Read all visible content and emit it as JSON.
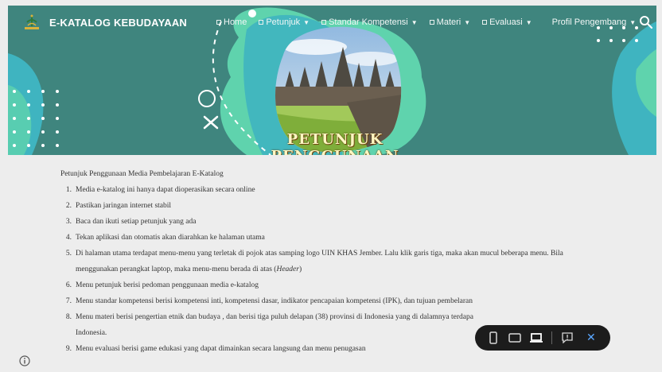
{
  "header": {
    "site_title": "E-KATALOG KEBUDAYAAN",
    "logo_icon": "logo-uin-khas-icon",
    "nav": [
      {
        "label": "Home",
        "dropdown": false
      },
      {
        "label": "Petunjuk",
        "dropdown": true
      },
      {
        "label": "Standar Kompetensi",
        "dropdown": true
      },
      {
        "label": "Materi",
        "dropdown": true
      },
      {
        "label": "Evaluasi",
        "dropdown": true
      },
      {
        "label": "Profil Pengembang",
        "dropdown": true
      }
    ],
    "search_icon": "search-icon"
  },
  "hero": {
    "banner_text": "PETUNJUK PENGGUNAAN",
    "colors": {
      "teal": "#3f857e",
      "mint": "#5fd3ad",
      "cyan": "#3fb4c0",
      "yellow_text": "#fff7c2"
    }
  },
  "content": {
    "title": "Petunjuk Penggunaan Media Pembelajaran E-Katalog",
    "steps": [
      {
        "num": "1.",
        "text": "Media e-katalog ini hanya dapat dioperasikan secara online"
      },
      {
        "num": "2.",
        "text": "Pastikan jaringan internet stabil"
      },
      {
        "num": "3.",
        "text": "Baca dan ikuti setiap petunjuk yang ada"
      },
      {
        "num": "4.",
        "text": "Tekan aplikasi dan otomatis akan diarahkan ke halaman utama"
      },
      {
        "num": "5.",
        "text": "Di halaman utama terdapat menu-menu yang terletak di pojok atas samping logo UIN KHAS Jember. Lalu klik garis tiga, maka akan mucul beberapa menu. Bila menggunakan perangkat laptop, maka menu-menu berada di atas (",
        "em": "Header",
        "tail": ")"
      },
      {
        "num": "6.",
        "text": "Menu petunjuk berisi pedoman penggunaan media e-katalog"
      },
      {
        "num": "7.",
        "text": "Menu standar kompetensi berisi kompetensi inti, kompetensi dasar, indikator pencapaian kompetensi (IPK), dan tujuan pembelaran"
      },
      {
        "num": "8.",
        "text": "Menu materi berisi pengertian etnik dan budaya , dan berisi tiga puluh delapan (38) provinsi di Indonesia yang di dalamnya terdapa",
        "tail2": "Indonesia."
      },
      {
        "num": "9.",
        "text": "Menu evaluasi berisi game edukasi yang dapat dimainkan secara langsung dan  menu penugasan"
      }
    ]
  },
  "toolbar": {
    "buttons": [
      "mobile-view-icon",
      "tablet-view-icon",
      "laptop-view-icon",
      "feedback-icon"
    ],
    "close_icon": "close-icon",
    "close_glyph": "✕"
  },
  "info_icon": "info-icon"
}
